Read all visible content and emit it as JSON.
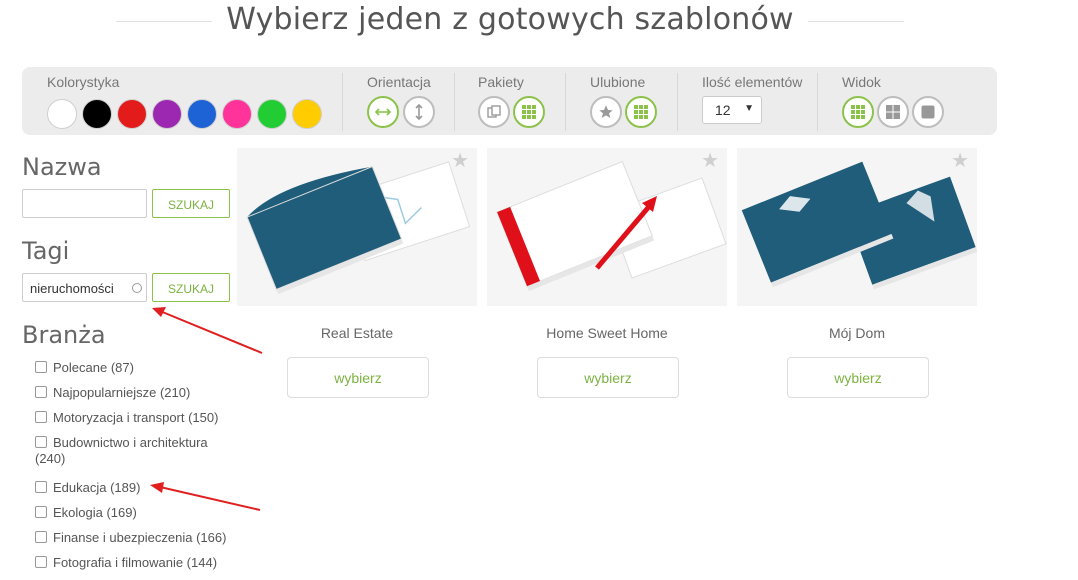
{
  "page": {
    "title": "Wybierz jeden z gotowych szablonów"
  },
  "filters": {
    "color_label": "Kolorystyka",
    "colors": [
      {
        "name": "white",
        "hex": "#ffffff"
      },
      {
        "name": "black",
        "hex": "#000000"
      },
      {
        "name": "red",
        "hex": "#e31b1b"
      },
      {
        "name": "purple",
        "hex": "#9c27b0"
      },
      {
        "name": "blue",
        "hex": "#1e63d6"
      },
      {
        "name": "pink",
        "hex": "#ff3399"
      },
      {
        "name": "green",
        "hex": "#22cc33"
      },
      {
        "name": "yellow",
        "hex": "#ffcc00"
      }
    ],
    "orientation_label": "Orientacja",
    "packages_label": "Pakiety",
    "favorites_label": "Ulubione",
    "count_label": "Ilość elementów",
    "count_value": "12",
    "view_label": "Widok"
  },
  "sidebar": {
    "name_heading": "Nazwa",
    "name_value": "",
    "search_label": "SZUKAJ",
    "tags_heading": "Tagi",
    "tags_value": "nieruchomości",
    "branch_heading": "Branża",
    "categories": [
      {
        "label": "Polecane (87)"
      },
      {
        "label": "Najpopularniejsze (210)"
      },
      {
        "label": "Motoryzacja i transport (150)"
      },
      {
        "label": "Budownictwo i architektura",
        "count": "(240)"
      },
      {
        "label": "Edukacja (189)"
      },
      {
        "label": "Ekologia (169)"
      },
      {
        "label": "Finanse i ubezpieczenia (166)"
      },
      {
        "label": "Fotografia i filmowanie (144)"
      }
    ]
  },
  "templates": [
    {
      "name": "Real Estate",
      "button": "wybierz"
    },
    {
      "name": "Home Sweet Home",
      "button": "wybierz"
    },
    {
      "name": "Mój Dom",
      "button": "wybierz"
    }
  ],
  "colors": {
    "accent": "#8bc34a",
    "annotation": "#e02020",
    "card_blue": "#1f5d7a",
    "card_red": "#e0101a"
  }
}
